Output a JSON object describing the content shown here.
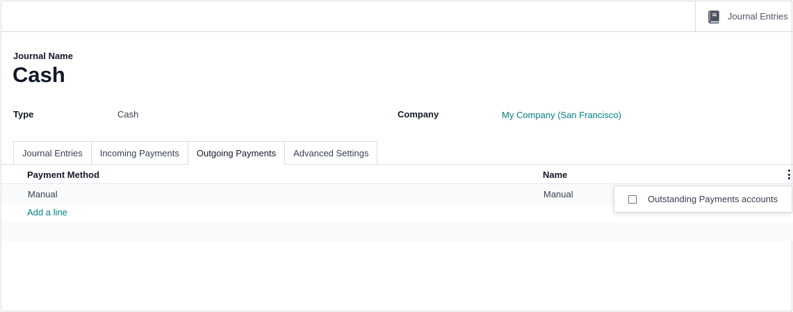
{
  "smart_button": {
    "icon": "book-icon",
    "label": "Journal Entries"
  },
  "journal": {
    "name_label": "Journal Name",
    "name": "Cash"
  },
  "fields": {
    "type_label": "Type",
    "type_value": "Cash",
    "company_label": "Company",
    "company_value": "My Company (San Francisco)"
  },
  "tabs": [
    {
      "label": "Journal Entries",
      "active": false
    },
    {
      "label": "Incoming Payments",
      "active": false
    },
    {
      "label": "Outgoing Payments",
      "active": true
    },
    {
      "label": "Advanced Settings",
      "active": false
    }
  ],
  "table": {
    "columns": [
      "Payment Method",
      "Name"
    ],
    "rows": [
      [
        "Manual",
        "Manual"
      ]
    ],
    "add_line_label": "Add a line"
  },
  "optional_columns": {
    "icon": "kebab-menu-icon",
    "options": [
      {
        "label": "Outstanding Payments accounts",
        "checked": false
      }
    ]
  },
  "colors": {
    "link": "#017e84",
    "border": "#d8dadd",
    "text": "#374151",
    "heading": "#111827"
  }
}
